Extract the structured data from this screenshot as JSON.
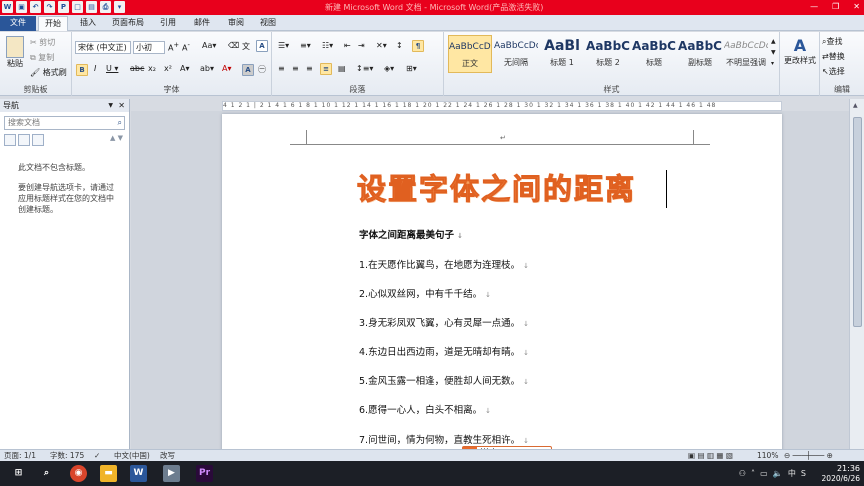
{
  "window": {
    "title": "新建 Microsoft Word 文档 - Microsoft Word(产品激活失败)"
  },
  "tabs": [
    {
      "label": "文件"
    },
    {
      "label": "开始"
    },
    {
      "label": "插入"
    },
    {
      "label": "页面布局"
    },
    {
      "label": "引用"
    },
    {
      "label": "邮件"
    },
    {
      "label": "审阅"
    },
    {
      "label": "视图"
    }
  ],
  "clipboard": {
    "paste": "粘贴",
    "cut": "剪切",
    "copy": "复制",
    "format_painter": "格式刷",
    "group": "剪贴板"
  },
  "font": {
    "family": "宋体 (中文正)",
    "size": "小初",
    "group": "字体"
  },
  "paragraph": {
    "group": "段落"
  },
  "styles": {
    "group": "样式",
    "items": [
      {
        "sample": "AaBbCcDd",
        "name": "正文",
        "selected": true
      },
      {
        "sample": "AaBbCcDd",
        "name": "无间隔",
        "selected": false
      },
      {
        "sample": "AaBl",
        "name": "标题 1",
        "selected": false
      },
      {
        "sample": "AaBbC",
        "name": "标题 2",
        "selected": false
      },
      {
        "sample": "AaBbC",
        "name": "标题",
        "selected": false
      },
      {
        "sample": "AaBbC",
        "name": "副标题",
        "selected": false
      },
      {
        "sample": "AaBbCcDd",
        "name": "不明显强调",
        "selected": false
      }
    ],
    "change_styles": "更改样式"
  },
  "editing": {
    "find": "查找",
    "replace": "替换",
    "select": "选择",
    "group": "编辑"
  },
  "nav": {
    "title": "导航",
    "search_placeholder": "搜索文档",
    "empty_line1": "此文档不包含标题。",
    "empty_line2": "要创建导航选项卡，请通过应用标题样式在您的文档中创建标题。"
  },
  "ruler": {
    "text": "4 1 2 1 | 2 1 4 1 6 1 8 1 10 1 12 1 14 1 16 1 18 1 20 1 22 1 24 1 26 1 28 1 30 1 32 1 34 1 36 1 38 1 40 1 42 1 44 1 46 1 48"
  },
  "document": {
    "title": "设置字体之间的距离",
    "lines": [
      "字体之间距离最美句子",
      "1.在天愿作比翼鸟，在地愿为连理枝。",
      "2.心似双丝网，中有千千结。",
      "3.身无彩凤双飞翼，心有灵犀一点通。",
      "4.东边日出西边雨，道是无晴却有晴。",
      "5.金风玉露一相逢，便胜却人间无数。",
      "6.愿得一心人，白头不相离。",
      "7.问世间，情为何物，直教生死相许。"
    ]
  },
  "status": {
    "page": "页面: 1/1",
    "words": "字数: 175",
    "language": "中文(中国)",
    "mode": "改写",
    "zoom": "110%"
  },
  "ime": {
    "label": "拼中"
  },
  "taskbar": {
    "time": "21:36",
    "date": "2020/6/26",
    "ime_indicator": "中"
  }
}
